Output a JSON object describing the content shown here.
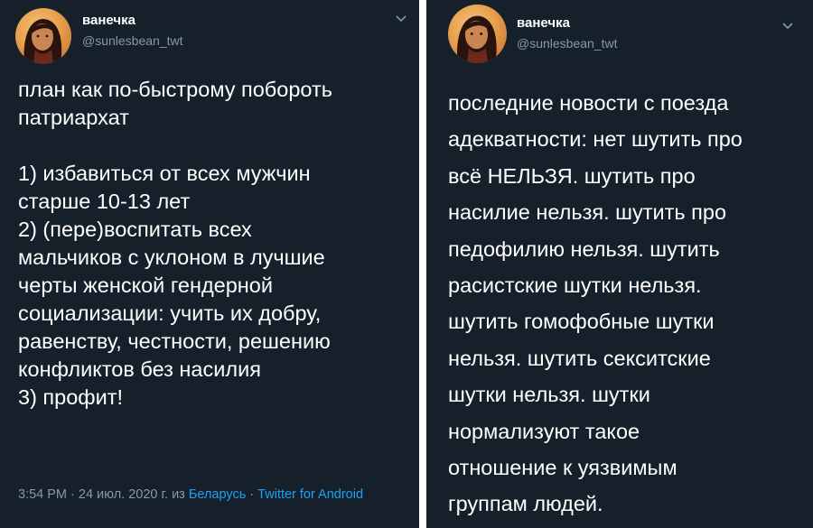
{
  "left": {
    "user": {
      "name": "ванечка",
      "handle": "@sunlesbean_twt",
      "avatar_icon": "avatar-portrait-icon"
    },
    "tweet_text": "план как по-быстрому побороть\nпатриархат\n\n1) избавиться от всех мужчин\nстарше 10-13 лет\n2) (пере)воспитать всех\nмальчиков с уклоном в лучшие\nчерты женской гендерной\nсоциализации: учить их добру,\nравенству, честности, решению\nконфликтов без насилия\n3) профит!",
    "meta": {
      "time_date": "3:54 PM · 24 июл. 2020 г. из ",
      "location": "Беларусь",
      "separator": " · ",
      "client": "Twitter for Android"
    }
  },
  "right": {
    "user": {
      "name": "ванечка",
      "handle": "@sunlesbean_twt",
      "avatar_icon": "avatar-portrait-icon"
    },
    "tweet_text": "последние новости с поезда\nадекватности: нет шутить про\nвсё НЕЛЬЗЯ. шутить про\nнасилие нельзя. шутить про\nпедофилию нельзя. шутить\nрасистские шутки нельзя.\nшутить гомофобные шутки\nнельзя. шутить секситские\nшутки нельзя. шутки\nнормализуют такое\nотношение к уязвимым\nгруппам людей."
  },
  "colors": {
    "background": "#15202b",
    "text": "#ffffff",
    "secondary_text": "#8899a6",
    "link": "#1da1f2",
    "divider": "#ffffff"
  },
  "icons": {
    "more_options": "chevron-down-icon"
  }
}
